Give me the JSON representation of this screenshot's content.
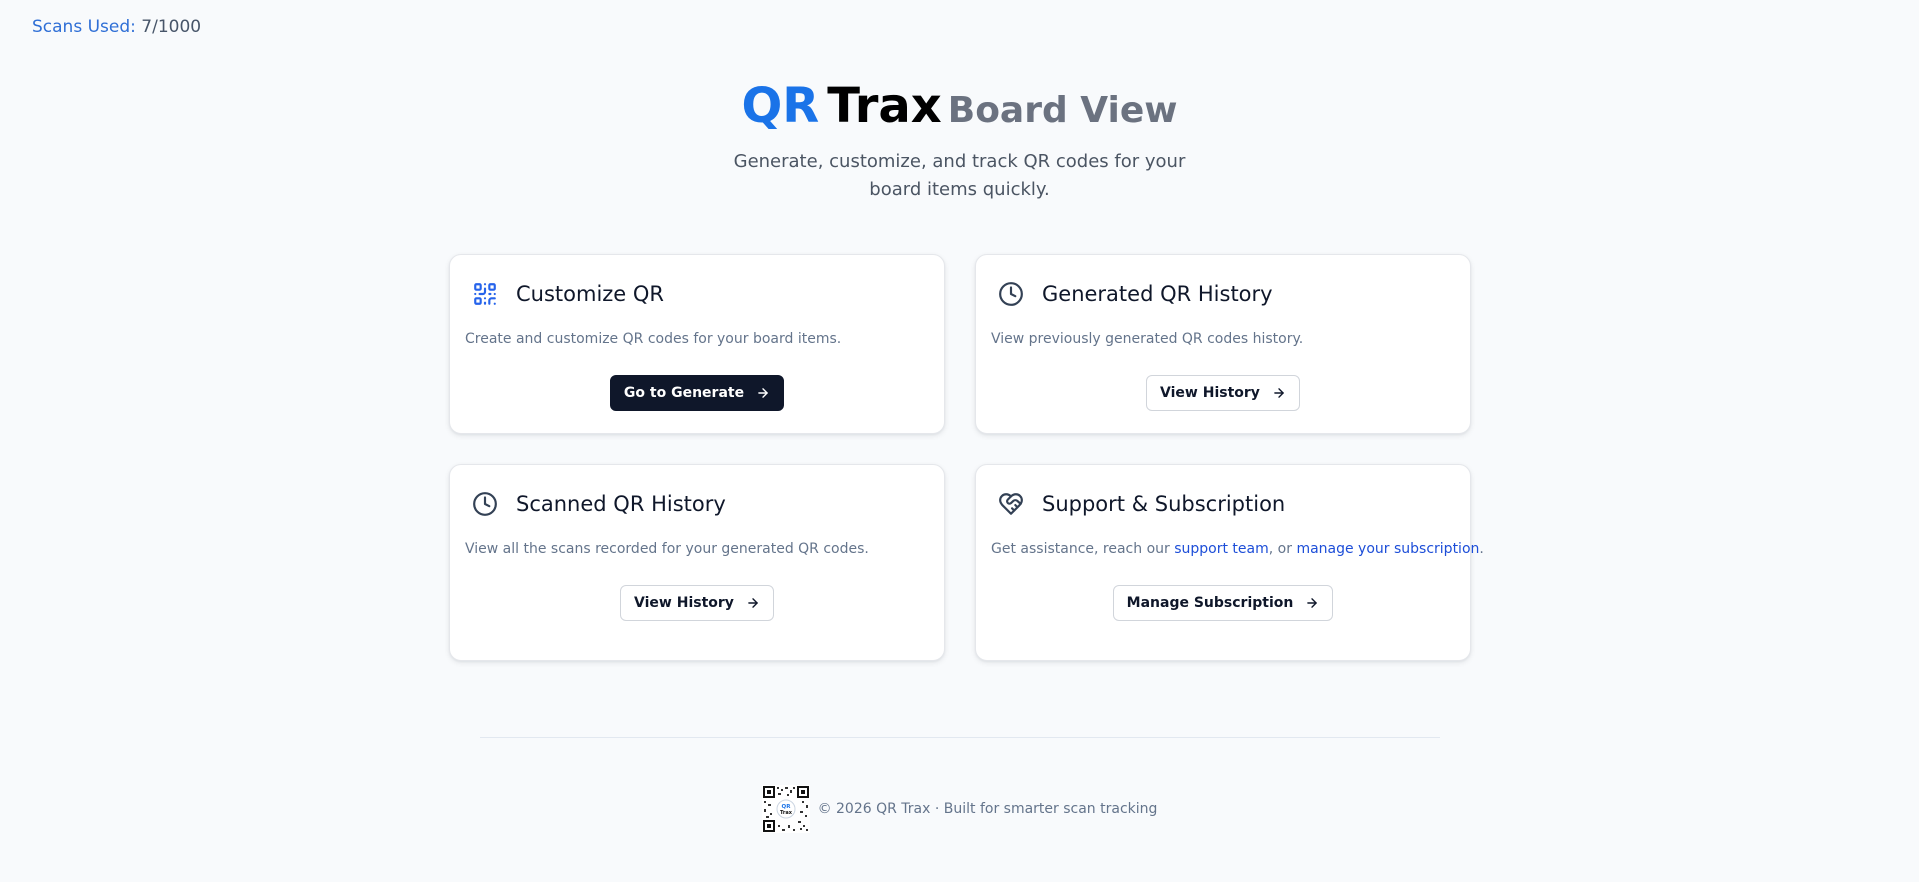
{
  "scans": {
    "label": "Scans Used:",
    "value": "7/1000"
  },
  "hero": {
    "title_qr": "QR",
    "title_trax": "Trax",
    "title_view": "Board View",
    "subtitle": "Generate, customize, and track QR codes for your board items quickly."
  },
  "cards": [
    {
      "title": "Customize QR",
      "icon": "qr-code-icon",
      "description": "Create and customize QR codes for your board items.",
      "button": "Go to Generate"
    },
    {
      "title": "Generated QR History",
      "icon": "clock-icon",
      "description": "View previously generated QR codes history.",
      "button": "View History"
    },
    {
      "title": "Scanned QR History",
      "icon": "clock-icon",
      "description": "View all the scans recorded for your generated QR codes.",
      "button": "View History"
    },
    {
      "title": "Support & Subscription",
      "icon": "heart-handshake-icon",
      "description_prefix": "Get assistance, reach our",
      "link_support": "support team",
      "description_mid": ", or",
      "link_subscription": "manage your subscription",
      "description_suffix": ".",
      "button": "Manage Subscription"
    }
  ],
  "footer": {
    "logo_text_top": "QR",
    "logo_text_bottom": "Trax",
    "copyright": "© 2026 QR Trax · Built for smarter scan tracking"
  },
  "colors": {
    "brand_blue": "#1a73e8",
    "dark_button": "#0f172a",
    "link_blue": "#1d4ed8",
    "background": "#f8fafc"
  }
}
